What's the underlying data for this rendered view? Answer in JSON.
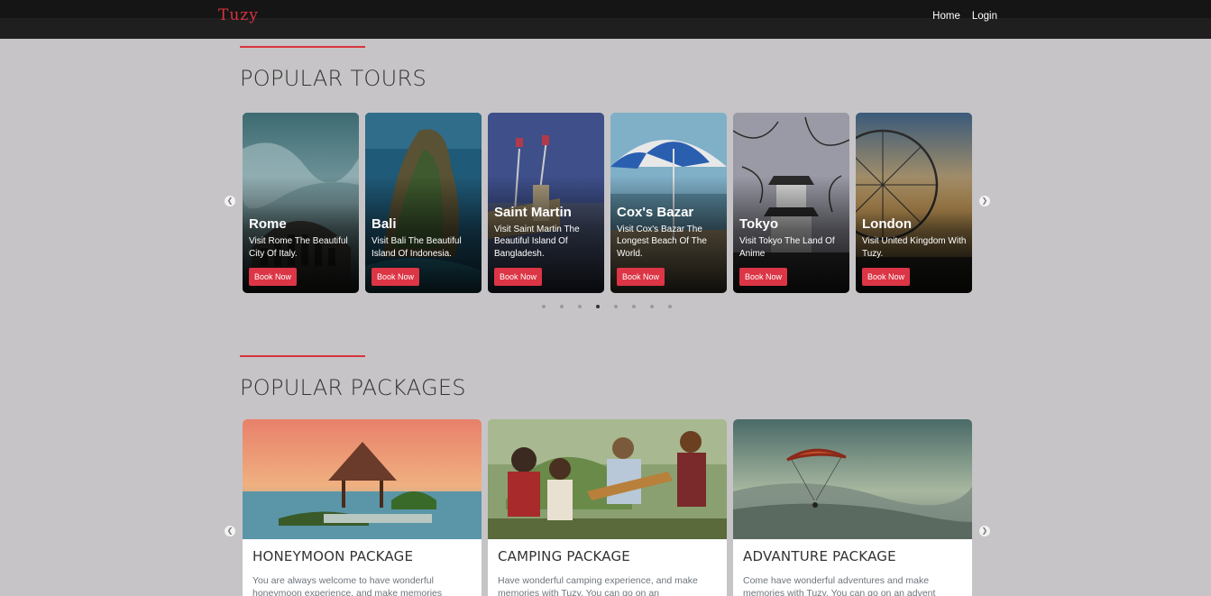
{
  "nav": {
    "brand": "Tuzy",
    "links": [
      "Home",
      "Login"
    ]
  },
  "tours": {
    "title": "POPULAR TOURS",
    "book_label": "Book Now",
    "cards": [
      {
        "name": "Rome",
        "desc": "Visit Rome The Beautiful City Of Italy."
      },
      {
        "name": "Bali",
        "desc": "Visit Bali The Beautiful Island Of Indonesia."
      },
      {
        "name": "Saint Martin",
        "desc": "Visit Saint Martin The Beautiful Island Of Bangladesh."
      },
      {
        "name": "Cox's Bazar",
        "desc": "Visit Cox's Bazar The Longest Beach Of The World."
      },
      {
        "name": "Tokyo",
        "desc": "Visit Tokyo The Land Of Anime"
      },
      {
        "name": "London",
        "desc": "Visit United Kingdom With Tuzy."
      }
    ],
    "dots_total": 8,
    "dots_active_index": 3
  },
  "packages": {
    "title": "POPULAR PACKAGES",
    "cards": [
      {
        "name": "HONEYMOON PACKAGE",
        "desc": "You are always welcome to have wonderful honeymoon experience, and make memories"
      },
      {
        "name": "CAMPING PACKAGE",
        "desc": "Have wonderful camping experience, and make memories with Tuzy. You can go on an"
      },
      {
        "name": "ADVANTURE PACKAGE",
        "desc": "Come have wonderful adventures and make memories with Tuzy. You can go on an advent"
      }
    ]
  },
  "icons": {
    "prev": "chevron-left-icon",
    "next": "chevron-right-icon"
  },
  "colors": {
    "accent": "#dc3545",
    "navbar": "#1f1f1f",
    "page_bg": "#c6c4c6"
  }
}
